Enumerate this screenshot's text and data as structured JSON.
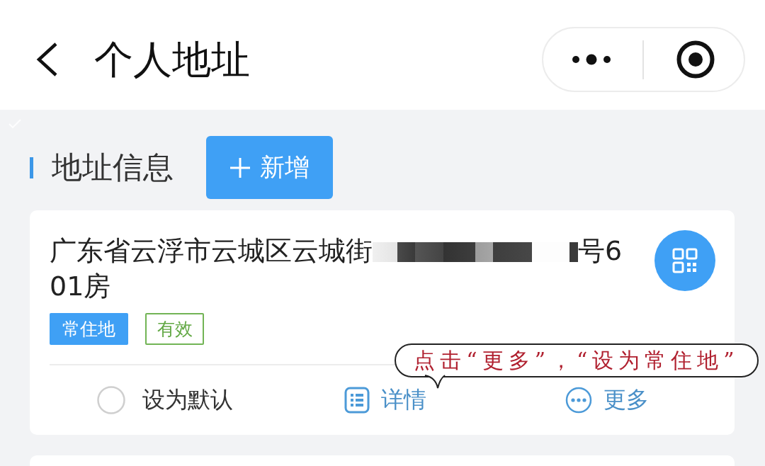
{
  "nav": {
    "title": "个人地址"
  },
  "section": {
    "title": "地址信息",
    "add_label": "新增"
  },
  "addresses": [
    {
      "line_1_start": "广东省云浮市云城区云城街",
      "redacted": true,
      "line_1_end": "号6",
      "line_2": "01房",
      "tags": [
        {
          "label": "常住地",
          "kind": "filled"
        },
        {
          "label": "有效",
          "kind": "outline"
        }
      ],
      "actions": [
        {
          "kind": "default",
          "label": "设为默认",
          "checked": false
        },
        {
          "kind": "details",
          "label": "详情"
        },
        {
          "kind": "more",
          "label": "更多"
        }
      ]
    }
  ],
  "annotation": {
    "text": "点击“更多”，“设为常住地”"
  }
}
